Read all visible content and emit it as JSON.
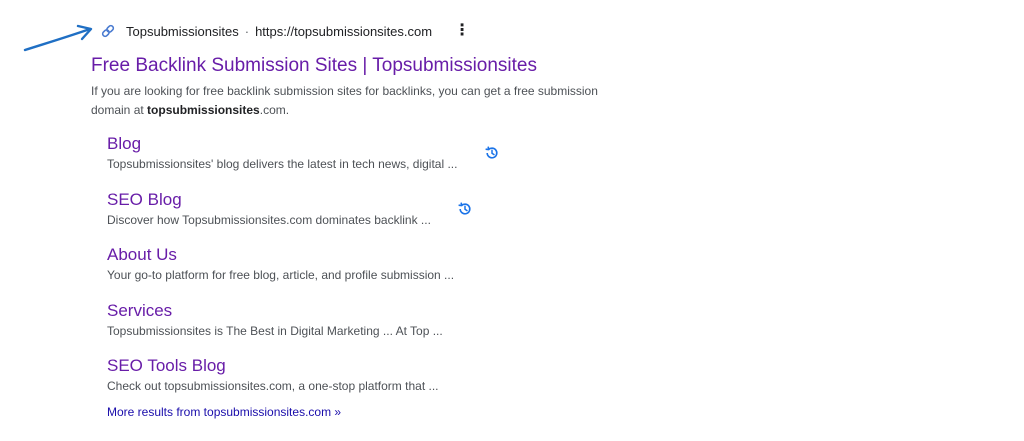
{
  "result": {
    "site_name": "Topsubmissionsites",
    "separator": "·",
    "url": "https://topsubmissionsites.com",
    "menu_glyph": "⋮",
    "title": "Free Backlink Submission Sites | Topsubmissionsites",
    "snippet_pre": "If you are looking for free backlink submission sites for backlinks, you can get a free submission domain at ",
    "snippet_bold": "topsubmissionsites",
    "snippet_post": ".com."
  },
  "sitelinks": [
    {
      "title": "Blog",
      "desc": "Topsubmissionsites' blog delivers the latest in tech news, digital ...",
      "history_icon": "history-icon"
    },
    {
      "title": "SEO Blog",
      "desc": "Discover how Topsubmissionsites.com dominates backlink ...",
      "history_icon": "history-icon"
    },
    {
      "title": "About Us",
      "desc": "Your go-to platform for free blog, article, and profile submission ..."
    },
    {
      "title": "Services",
      "desc": "Topsubmissionsites is The Best in Digital Marketing ... At Top ..."
    },
    {
      "title": "SEO Tools Blog",
      "desc": "Check out topsubmissionsites.com, a one-stop platform that ..."
    }
  ],
  "more_results": "More results from topsubmissionsites.com »",
  "colors": {
    "visited_link": "#681da8",
    "link": "#1a0dab",
    "annotation_arrow": "#1f6fc4",
    "history_icon": "#1a73e8"
  }
}
